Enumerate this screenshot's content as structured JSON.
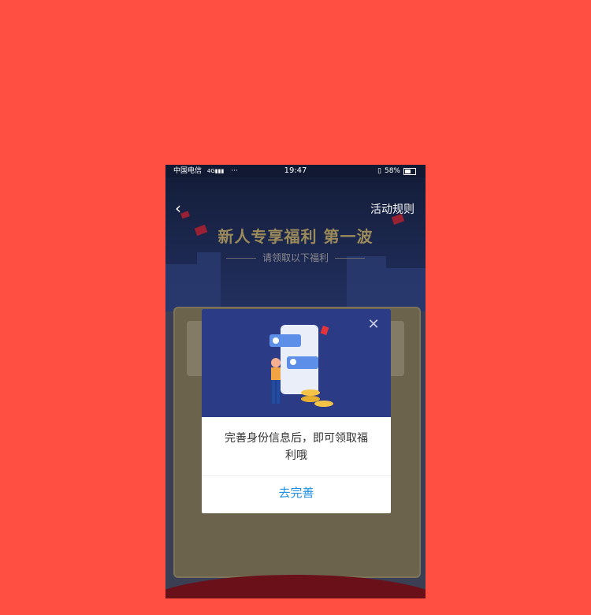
{
  "status_bar": {
    "carrier": "中国电信",
    "network_icon": "4G-2G-signal-icon",
    "more": "···",
    "time": "19:47",
    "battery": "58%"
  },
  "header": {
    "back_icon": "chevron-left-icon",
    "rules_label": "活动规则"
  },
  "hero": {
    "title": "新人专享福利 第一波",
    "subtitle": "请领取以下福利"
  },
  "dialog": {
    "close_icon": "close-icon",
    "message": "完善身份信息后，即可领取福利哦",
    "action_label": "去完善",
    "colors": {
      "header_bg": "#2B3B86",
      "action": "#1C8FE2"
    }
  },
  "colors": {
    "outer_bg": "#FF4F43"
  }
}
